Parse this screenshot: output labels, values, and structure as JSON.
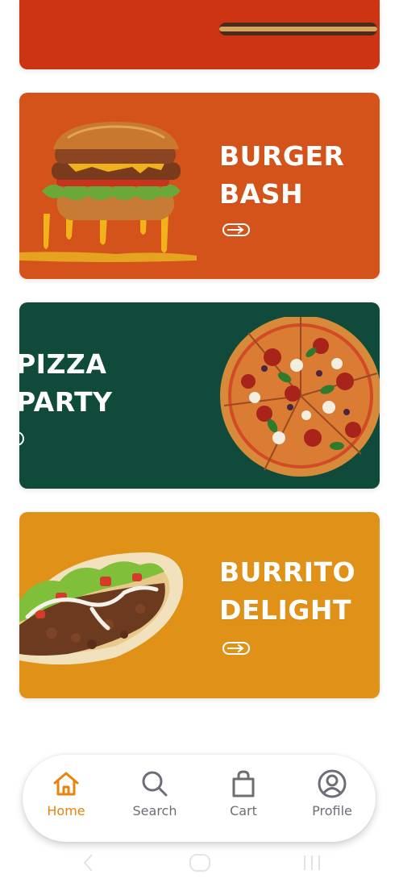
{
  "cards": [
    {
      "title_line1": "BURGER",
      "title_line2": "BASH",
      "color": "#d4531a"
    },
    {
      "title_line1": "PIZZA",
      "title_line2": "PARTY",
      "color": "#0f4a3a"
    },
    {
      "title_line1": "BURRITO",
      "title_line2": "DELIGHT",
      "color": "#e09118"
    }
  ],
  "top_card": {
    "color": "#cc3412"
  },
  "nav": {
    "active": "Home",
    "accent_color": "#e8840e",
    "items": [
      {
        "label": "Home",
        "icon": "home-icon"
      },
      {
        "label": "Search",
        "icon": "search-icon"
      },
      {
        "label": "Cart",
        "icon": "shopping-bag-icon"
      },
      {
        "label": "Profile",
        "icon": "profile-icon"
      }
    ]
  }
}
